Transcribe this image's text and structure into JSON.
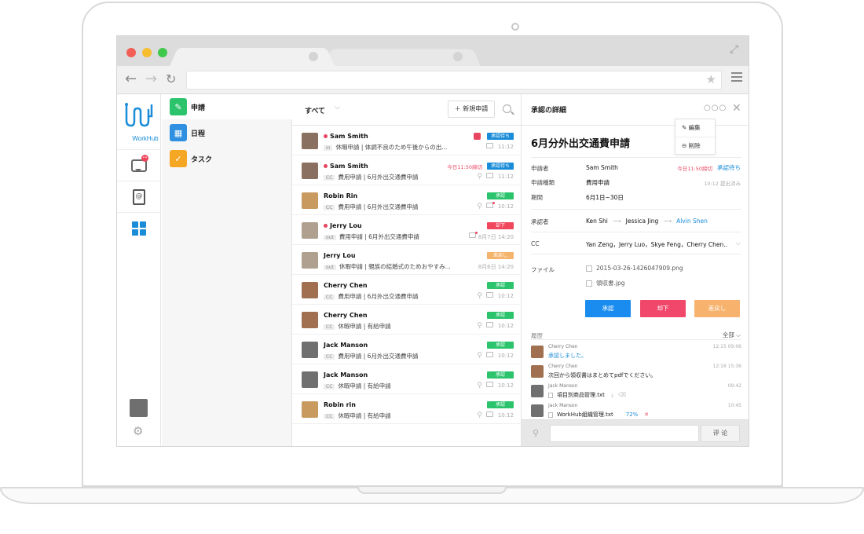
{
  "app": {
    "logo_text": "WorkHub"
  },
  "rail": {
    "notification_count": "••"
  },
  "categories": [
    {
      "label": "申請",
      "color": "#2bc46d",
      "icon": "pencil-icon"
    },
    {
      "label": "日程",
      "color": "#2f8fe0",
      "icon": "calendar-icon"
    },
    {
      "label": "タスク",
      "color": "#f5a623",
      "icon": "check-icon"
    }
  ],
  "list": {
    "filter": "すべて",
    "new_button": "＋ 新規申請",
    "rows": [
      {
        "name": "Sam Smith",
        "unread": true,
        "tag": "in",
        "subject": "休暇申請 | 体調不良のため午後からの出...",
        "badge": "承認待ち",
        "badge_color": "#1a8cd8",
        "time": "11:12",
        "deadline": "",
        "avatar": "#8a7060"
      },
      {
        "name": "Sam Smith",
        "unread": true,
        "tag": "CC",
        "subject": "費用申請 | 6月外出交通費申請",
        "badge": "承認待ち",
        "badge_color": "#1a8cd8",
        "time": "11:12",
        "deadline": "今日11:50締切",
        "avatar": "#8a7060"
      },
      {
        "name": "Robin Rin",
        "unread": false,
        "tag": "CC",
        "subject": "費用申請 | 6月外出交通費申請",
        "badge": "承認",
        "badge_color": "#2bc46d",
        "time": "10:12",
        "deadline": "",
        "avatar": "#c89a60"
      },
      {
        "name": "Jerry Lou",
        "unread": true,
        "tag": "out",
        "subject": "費用申請 | 6月外出交通費申請",
        "badge": "却下",
        "badge_color": "#f0475d",
        "time": "8月7日 14:20",
        "deadline": "",
        "avatar": "#b0a090"
      },
      {
        "name": "Jerry Lou",
        "unread": false,
        "tag": "out",
        "subject": "休暇申請 | 親族の結婚式のためおやすみ...",
        "badge": "差戻し",
        "badge_color": "#f5b46c",
        "time": "8月6日 14:20",
        "deadline": "",
        "avatar": "#b0a090"
      },
      {
        "name": "Cherry Chen",
        "unread": false,
        "tag": "CC",
        "subject": "費用申請 | 6月外出交通費申請",
        "badge": "承認",
        "badge_color": "#2bc46d",
        "time": "10:12",
        "deadline": "",
        "avatar": "#a07050"
      },
      {
        "name": "Cherry Chen",
        "unread": false,
        "tag": "CC",
        "subject": "休暇申請 | 有給申請",
        "badge": "承認",
        "badge_color": "#2bc46d",
        "time": "10:12",
        "deadline": "",
        "avatar": "#a07050"
      },
      {
        "name": "Jack Manson",
        "unread": false,
        "tag": "CC",
        "subject": "費用申請 | 6月外出交通費申請",
        "badge": "承認",
        "badge_color": "#2bc46d",
        "time": "10:12",
        "deadline": "",
        "avatar": "#707070"
      },
      {
        "name": "Jack Manson",
        "unread": false,
        "tag": "CC",
        "subject": "休暇申請 | 有給申請",
        "badge": "承認",
        "badge_color": "#2bc46d",
        "time": "10:12",
        "deadline": "",
        "avatar": "#707070"
      },
      {
        "name": "Robin rin",
        "unread": false,
        "tag": "CC",
        "subject": "休暇申請 | 有給申請",
        "badge": "承認",
        "badge_color": "#2bc46d",
        "time": "10:12",
        "deadline": "",
        "avatar": "#c89a60"
      }
    ]
  },
  "detail": {
    "header": "承認の詳細",
    "menu": [
      "編集",
      "削除"
    ],
    "title": "6月分外出交通費申請",
    "applicant_label": "申請者",
    "applicant": "Sam Smith",
    "deadline": "今日11:50締切",
    "status": "承認待ち",
    "type_label": "申請種類",
    "type": "費用申請",
    "submitted": "10:12 提出済み",
    "period_label": "期間",
    "period": "6月1日~30日",
    "approver_label": "承認者",
    "approvers": [
      "Ken Shi",
      "Jessica Jing",
      "Alvin Shen"
    ],
    "cc_label": "CC",
    "cc": "Yan Zeng，Jerry Luo，Skye Feng，Cherry Chen...",
    "file_label": "ファイル",
    "files": [
      "2015-03-26-1426047909.png",
      "領収書.jpg"
    ],
    "buttons": {
      "approve": "承認",
      "reject": "却下",
      "return": "差戻し"
    },
    "history_label": "履歴",
    "history_filter": "全部",
    "history": [
      {
        "name": "Cherry Chen",
        "text": "承認しました。",
        "time": "12:15 09:06",
        "highlight": true,
        "avatar": "#a07050"
      },
      {
        "name": "Cherry Chen",
        "text": "次回から領収書はまとめてpdfでください。",
        "time": "12:16 15:36",
        "highlight": false,
        "avatar": "#a07050"
      },
      {
        "name": "Jack Manson",
        "text": "項目別商品管理.txt",
        "time": "09:42",
        "highlight": false,
        "avatar": "#707070"
      },
      {
        "name": "Jack Manson",
        "text": "WorkHub組織管理.txt",
        "time": "10:45",
        "highlight": false,
        "avatar": "#707070",
        "progress": "72%"
      }
    ],
    "comment_button": "评 论"
  }
}
